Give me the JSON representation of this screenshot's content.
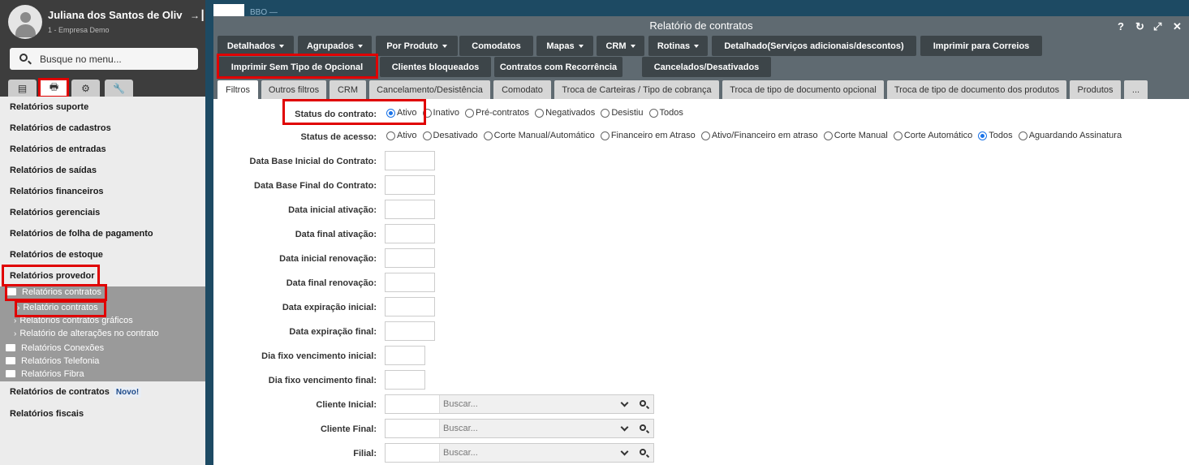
{
  "user": {
    "name": "Juliana dos Santos de Oliv",
    "company": "1 - Empresa Demo"
  },
  "search": {
    "placeholder": "Busque no menu..."
  },
  "menu": {
    "items": [
      "Relatórios suporte",
      "Relatórios de cadastros",
      "Relatórios de entradas",
      "Relatórios de saídas",
      "Relatórios financeiros",
      "Relatórios gerenciais",
      "Relatórios de folha de pagamento",
      "Relatórios de estoque",
      "Relatórios provedor"
    ],
    "provedor_sub": {
      "contratos": "Relatórios contratos",
      "contratos_children": [
        "Relatório contratos",
        "Relatórios contratos gráficos",
        "Relatório de alterações no contrato"
      ],
      "conexoes": "Relatórios Conexões",
      "telefonia": "Relatórios Telefonia",
      "fibra": "Relatórios Fibra"
    },
    "after": [
      {
        "label": "Relatórios de contratos",
        "badge": "Novo!"
      },
      {
        "label": "Relatórios fiscais"
      }
    ]
  },
  "background": {
    "app_label": "BBO —"
  },
  "window": {
    "title": "Relatório de contratos",
    "toolbar_row1": [
      "Detalhados",
      "Agrupados",
      "Por Produto",
      "Comodatos",
      "Mapas",
      "CRM",
      "Rotinas",
      "Detalhado(Serviços adicionais/descontos)",
      "Imprimir para Correios"
    ],
    "toolbar_row2": [
      "Imprimir Sem Tipo de Opcional",
      "Clientes bloqueados",
      "Contratos com Recorrência",
      "Cancelados/Desativados"
    ],
    "tabs": [
      "Filtros",
      "Outros filtros",
      "CRM",
      "Cancelamento/Desistência",
      "Comodato",
      "Troca de Carteiras / Tipo de cobrança",
      "Troca de tipo de documento opcional",
      "Troca de tipo de documento dos produtos",
      "Produtos",
      "..."
    ]
  },
  "form": {
    "status_contrato": {
      "label": "Status do contrato:",
      "options": [
        "Ativo",
        "Inativo",
        "Pré-contratos",
        "Negativados",
        "Desistiu",
        "Todos"
      ],
      "selected": "Ativo"
    },
    "status_acesso": {
      "label": "Status de acesso:",
      "options": [
        "Ativo",
        "Desativado",
        "Corte Manual/Automático",
        "Financeiro em Atraso",
        "Ativo/Financeiro em atraso",
        "Corte Manual",
        "Corte Automático",
        "Todos",
        "Aguardando Assinatura"
      ],
      "selected": "Todos"
    },
    "fields": [
      "Data Base Inicial do Contrato:",
      "Data Base Final do Contrato:",
      "Data inicial ativação:",
      "Data final ativação:",
      "Data inicial renovação:",
      "Data final renovação:",
      "Data expiração inicial:",
      "Data expiração final:",
      "Dia fixo vencimento inicial:",
      "Dia fixo vencimento final:"
    ],
    "combos": [
      {
        "label": "Cliente Inicial:",
        "placeholder": "Buscar..."
      },
      {
        "label": "Cliente Final:",
        "placeholder": "Buscar..."
      },
      {
        "label": "Filial:",
        "placeholder": "Buscar..."
      }
    ]
  },
  "colors": {
    "sidebar_bg": "#3d3d3d",
    "window_bar": "#5f6a71",
    "button_bg": "#3d4549",
    "highlight": "#e00000",
    "radio_selected": "#1a73e8"
  }
}
